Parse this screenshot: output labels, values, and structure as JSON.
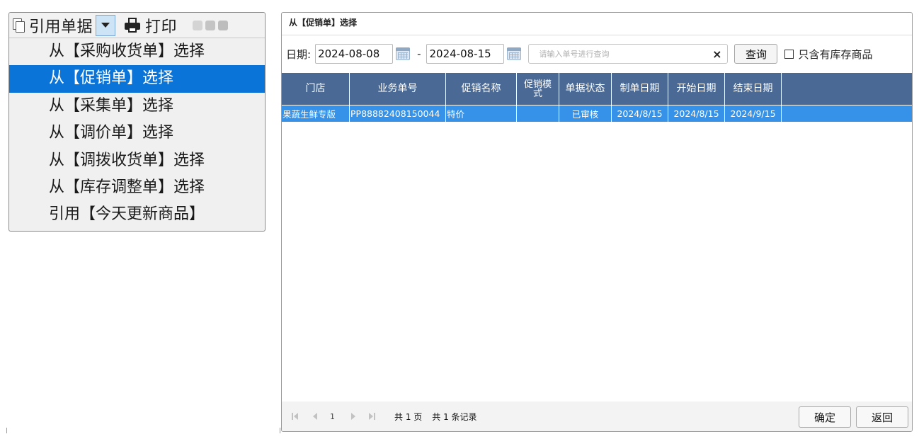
{
  "toolbar": {
    "cite_label": "引用单据",
    "print_label": "打印"
  },
  "menu": {
    "items": [
      {
        "label": "从【采购收货单】选择",
        "selected": false
      },
      {
        "label": "从【促销单】选择",
        "selected": true
      },
      {
        "label": "从【采集单】选择",
        "selected": false
      },
      {
        "label": "从【调价单】选择",
        "selected": false
      },
      {
        "label": "从【调拨收货单】选择",
        "selected": false
      },
      {
        "label": "从【库存调整单】选择",
        "selected": false
      },
      {
        "label": "引用【今天更新商品】",
        "selected": false
      }
    ]
  },
  "dialog": {
    "title": "从【促销单】选择",
    "filter": {
      "date_label": "日期:",
      "date_from": "2024-08-08",
      "range_sep": "-",
      "date_to": "2024-08-15",
      "search_placeholder": "请输入单号进行查询",
      "clear_symbol": "×",
      "query_label": "查询",
      "stock_only_label": "只含有库存商品"
    },
    "table": {
      "columns": [
        "门店",
        "业务单号",
        "促销名称",
        "促销模式",
        "单据状态",
        "制单日期",
        "开始日期",
        "结束日期"
      ],
      "rows": [
        {
          "store": "果蔬生鲜专版",
          "doc_no": "PP88882408150044",
          "promo_name": "特价",
          "promo_mode": "",
          "status": "已审核",
          "created": "2024/8/15",
          "start": "2024/8/15",
          "end": "2024/9/15"
        }
      ]
    },
    "pager": {
      "page": "1",
      "total_pages": "共 1 页",
      "total_records": "共 1 条记录"
    },
    "buttons": {
      "ok": "确定",
      "back": "返回"
    }
  },
  "colors": {
    "header_bg": "#4a6a95",
    "row_selected": "#3592e8",
    "menu_selected": "#0a74d9"
  }
}
